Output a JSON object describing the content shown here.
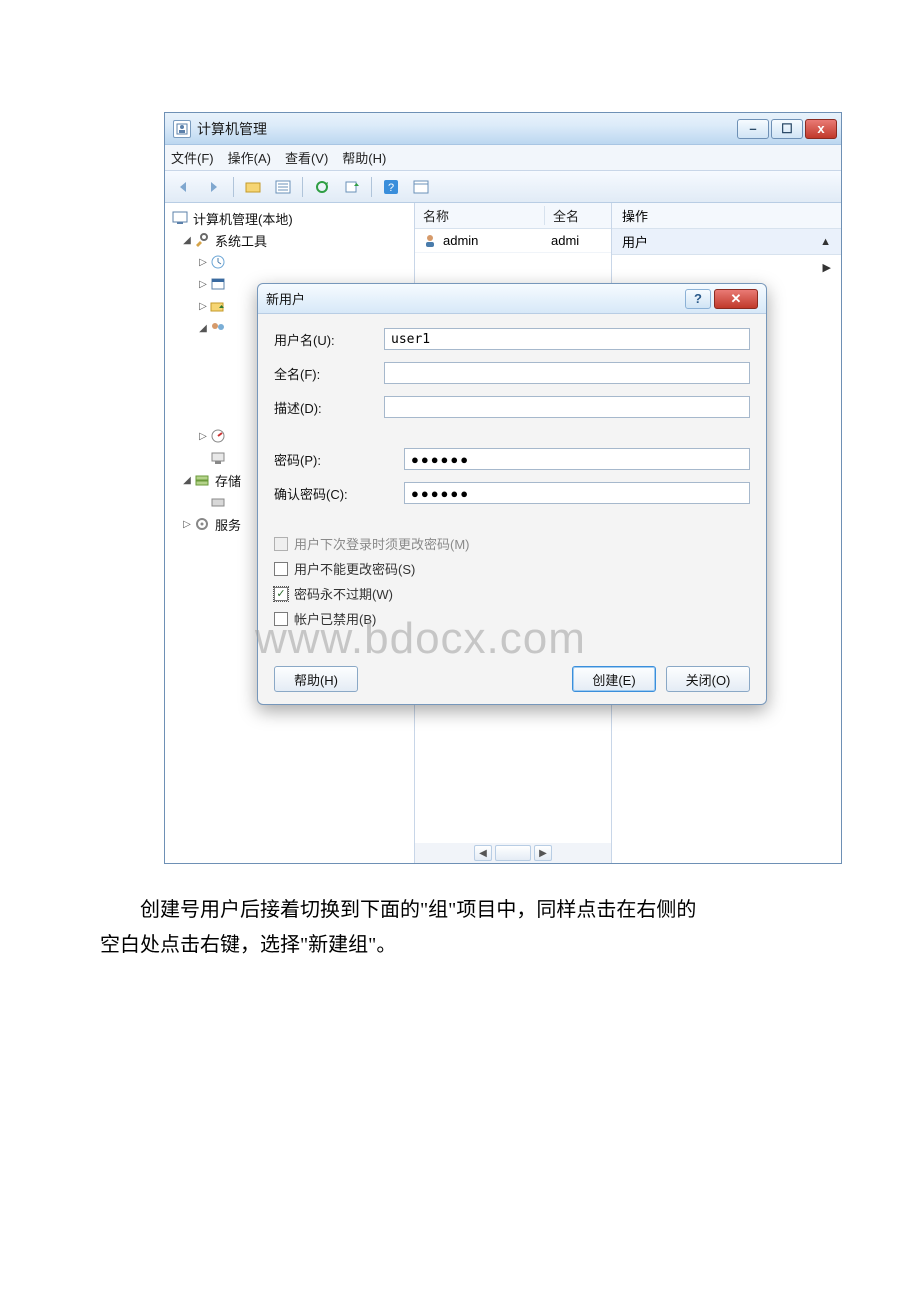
{
  "window": {
    "title": "计算机管理",
    "controls": {
      "min": "–",
      "max": "☐",
      "close": "x"
    }
  },
  "menu": {
    "file": "文件(F)",
    "action": "操作(A)",
    "view": "查看(V)",
    "help": "帮助(H)"
  },
  "tree": {
    "root": "计算机管理(本地)",
    "systools": "系统工具",
    "nodes": [
      "",
      "",
      "",
      ""
    ],
    "storage": "存储",
    "services": "服务"
  },
  "middle": {
    "col_name": "名称",
    "col_fullname": "全名",
    "row1_name": "admin",
    "row1_full": "admi"
  },
  "right": {
    "header": "操作",
    "row": "用户"
  },
  "dialog": {
    "title": "新用户",
    "username_label": "用户名(U):",
    "username_value": "user1",
    "fullname_label": "全名(F):",
    "desc_label": "描述(D):",
    "pw_label": "密码(P):",
    "pw_value": "●●●●●●",
    "pwc_label": "确认密码(C):",
    "pwc_value": "●●●●●●",
    "chk_mustchange": "用户下次登录时须更改密码(M)",
    "chk_cannotchange": "用户不能更改密码(S)",
    "chk_neverexpire": "密码永不过期(W)",
    "chk_disabled": "帐户已禁用(B)",
    "btn_help": "帮助(H)",
    "btn_create": "创建(E)",
    "btn_close": "关闭(O)"
  },
  "watermark": "www.bdocx.com",
  "caption_line1": "创建号用户后接着切换到下面的\"组\"项目中，同样点击在右侧的",
  "caption_line2": "空白处点击右键，选择\"新建组\"。"
}
